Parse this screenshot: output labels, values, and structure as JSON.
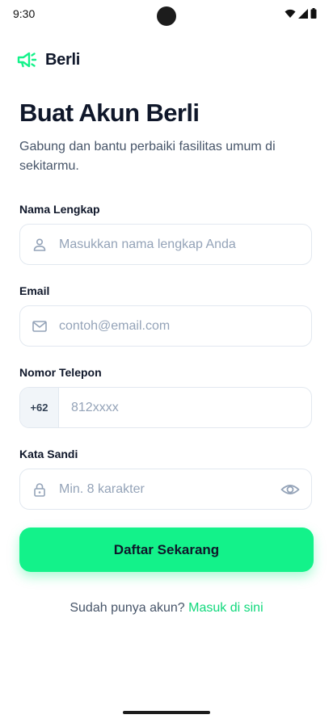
{
  "status_bar": {
    "time": "9:30"
  },
  "app": {
    "name": "Berli",
    "logo_icon": "megaphone-icon"
  },
  "header": {
    "title": "Buat Akun Berli",
    "subtitle": "Gabung dan bantu perbaiki fasilitas umum di sekitarmu."
  },
  "form": {
    "full_name": {
      "label": "Nama Lengkap",
      "placeholder": "Masukkan nama lengkap Anda",
      "icon": "user-icon"
    },
    "email": {
      "label": "Email",
      "placeholder": "contoh@email.com",
      "icon": "mail-icon"
    },
    "phone": {
      "label": "Nomor Telepon",
      "prefix": "+62",
      "placeholder": "812xxxx"
    },
    "password": {
      "label": "Kata Sandi",
      "placeholder": "Min. 8 karakter",
      "icon": "lock-icon",
      "toggle_icon": "eye-icon"
    },
    "submit_label": "Daftar Sekarang"
  },
  "footer": {
    "prompt_text": "Sudah punya akun?",
    "login_link": "Masuk di sini"
  },
  "colors": {
    "accent": "#13f28a",
    "link": "#10d97c",
    "text_primary": "#0f172a",
    "text_secondary": "#475569",
    "placeholder": "#94a3b8",
    "border": "#e2e8f0"
  }
}
